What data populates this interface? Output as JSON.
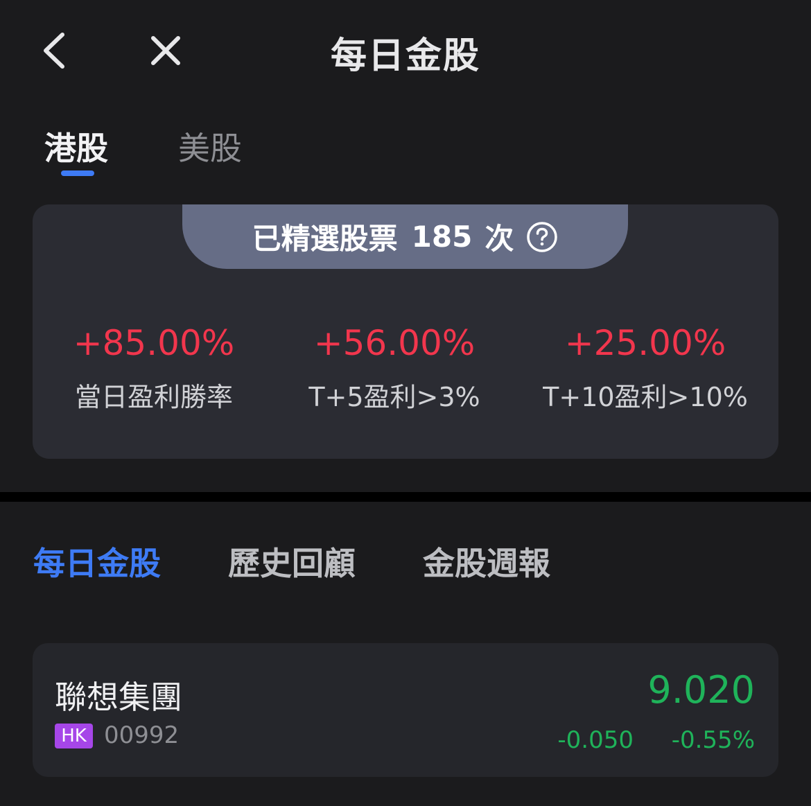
{
  "header": {
    "title": "每日金股",
    "back_icon": "chevron-left-icon",
    "close_icon": "close-icon"
  },
  "market_tabs": [
    {
      "label": "港股",
      "active": true
    },
    {
      "label": "美股",
      "active": false
    }
  ],
  "summary": {
    "prefix": "已精選股票",
    "count": "185",
    "suffix": "次",
    "help_icon": "question-circle-icon"
  },
  "stats": [
    {
      "value": "+85.00%",
      "label": "當日盈利勝率"
    },
    {
      "value": "+56.00%",
      "label": "T+5盈利>3%"
    },
    {
      "value": "+25.00%",
      "label": "T+10盈利>10%"
    }
  ],
  "section_tabs": [
    {
      "label": "每日金股",
      "active": true
    },
    {
      "label": "歷史回顧",
      "active": false
    },
    {
      "label": "金股週報",
      "active": false
    }
  ],
  "stocks": [
    {
      "name": "聯想集團",
      "market": "HK",
      "code": "00992",
      "price": "9.020",
      "change": "-0.050",
      "change_pct": "-0.55%"
    }
  ],
  "colors": {
    "background": "#1b1b1d",
    "accent": "#3e7bf5",
    "gain": "#f2364d",
    "loss": "#1fb35a",
    "market_badge": "#a646e8"
  }
}
